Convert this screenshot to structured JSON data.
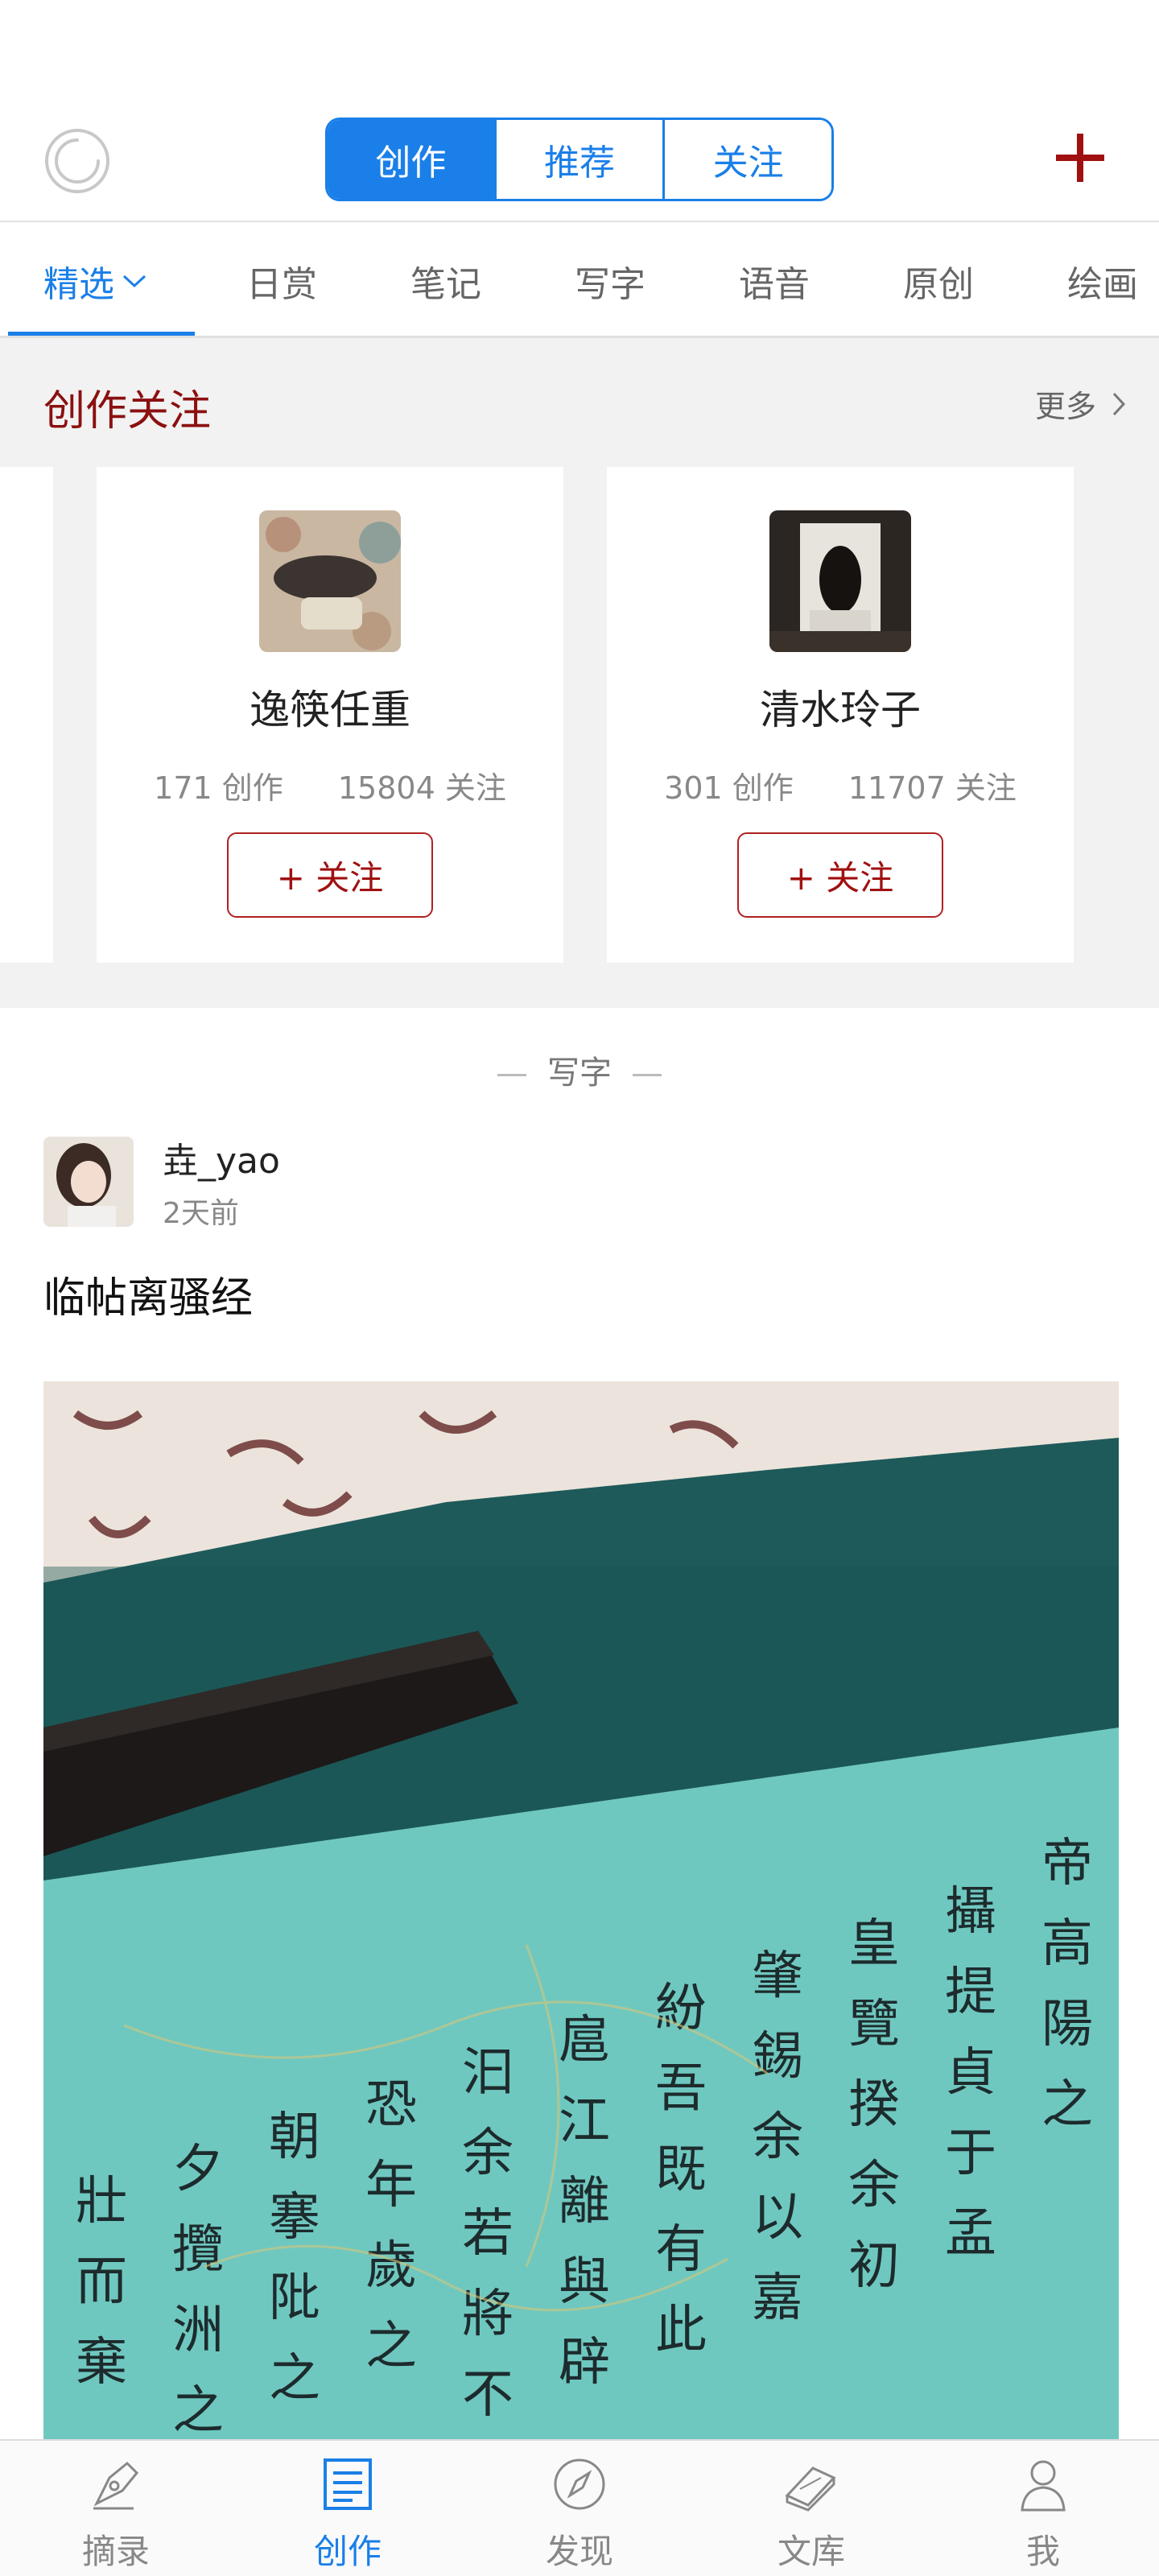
{
  "header": {
    "segments": [
      {
        "label": "创作",
        "active": true
      },
      {
        "label": "推荐",
        "active": false
      },
      {
        "label": "关注",
        "active": false
      }
    ],
    "loader_icon": "circle-refresh-icon",
    "add_icon": "plus-icon",
    "accent_color": "#1a7fe8",
    "brand_red": "#8b1010"
  },
  "tabs": [
    {
      "label": "精选",
      "active": true,
      "has_dropdown": true
    },
    {
      "label": "日赏"
    },
    {
      "label": "笔记"
    },
    {
      "label": "写字"
    },
    {
      "label": "语音"
    },
    {
      "label": "原创"
    },
    {
      "label": "绘画"
    }
  ],
  "follow_section": {
    "title": "创作关注",
    "more_label": "更多",
    "cards": [
      {
        "name": "逸筷任重",
        "works": "171 创作",
        "followers": "15804 关注",
        "button": "+ 关注"
      },
      {
        "name": "清水玲子",
        "works": "301 创作",
        "followers": "11707 关注",
        "button": "+ 关注"
      }
    ]
  },
  "post": {
    "category": "写字",
    "author": "垚_yao",
    "time": "2天前",
    "title": "临帖离骚经"
  },
  "bottom_nav": [
    {
      "label": "摘录",
      "icon": "pen-nib-icon",
      "active": false
    },
    {
      "label": "创作",
      "icon": "document-icon",
      "active": true
    },
    {
      "label": "发现",
      "icon": "compass-icon",
      "active": false
    },
    {
      "label": "文库",
      "icon": "book-icon",
      "active": false
    },
    {
      "label": "我",
      "icon": "person-icon",
      "active": false
    }
  ]
}
